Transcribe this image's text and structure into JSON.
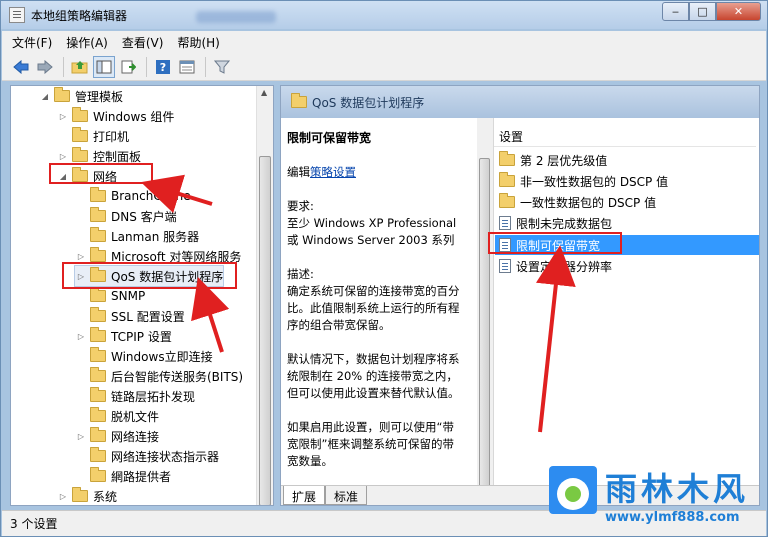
{
  "window": {
    "title": "本地组策略编辑器",
    "buttons": {
      "minimize": "‒",
      "maximize": "□",
      "close": "✕"
    }
  },
  "menu": [
    "文件(F)",
    "操作(A)",
    "查看(V)",
    "帮助(H)"
  ],
  "toolbar": {
    "icons": [
      "back-arrow-icon",
      "forward-arrow-icon",
      "up-folder-icon",
      "show-hide-tree-icon",
      "export-list-icon",
      "help-icon",
      "properties-icon",
      "filter-icon"
    ]
  },
  "tree": {
    "items": [
      {
        "label": "管理模板",
        "arrow": "◢",
        "indent": 0
      },
      {
        "label": "Windows 组件",
        "arrow": "▷",
        "indent": 1
      },
      {
        "label": "打印机",
        "arrow": "",
        "indent": 1
      },
      {
        "label": "控制面板",
        "arrow": "▷",
        "indent": 1
      },
      {
        "label": "网络",
        "arrow": "◢",
        "indent": 1
      },
      {
        "label": "BranchCache",
        "arrow": "",
        "indent": 2
      },
      {
        "label": "DNS 客户端",
        "arrow": "",
        "indent": 2
      },
      {
        "label": "Lanman 服务器",
        "arrow": "",
        "indent": 2
      },
      {
        "label": "Microsoft 对等网络服务",
        "arrow": "▷",
        "indent": 2
      },
      {
        "label": "QoS 数据包计划程序",
        "arrow": "▷",
        "indent": 2
      },
      {
        "label": "SNMP",
        "arrow": "",
        "indent": 2
      },
      {
        "label": "SSL 配置设置",
        "arrow": "",
        "indent": 2
      },
      {
        "label": "TCPIP 设置",
        "arrow": "▷",
        "indent": 2
      },
      {
        "label": "Windows立即连接",
        "arrow": "",
        "indent": 2
      },
      {
        "label": "后台智能传送服务(BITS)",
        "arrow": "",
        "indent": 2
      },
      {
        "label": "链路层拓扑发现",
        "arrow": "",
        "indent": 2
      },
      {
        "label": "脱机文件",
        "arrow": "",
        "indent": 2
      },
      {
        "label": "网络连接",
        "arrow": "▷",
        "indent": 2
      },
      {
        "label": "网络连接状态指示器",
        "arrow": "",
        "indent": 2
      },
      {
        "label": "網路提供者",
        "arrow": "",
        "indent": 2
      },
      {
        "label": "系统",
        "arrow": "▷",
        "indent": 1
      }
    ]
  },
  "right": {
    "header": "QoS 数据包计划程序",
    "description": {
      "title": "限制可保留带宽",
      "edit_prefix": "编辑",
      "edit_link": "策略设置",
      "req_label": "要求:",
      "req_line1": "至少 Windows XP Professional",
      "req_line2": "或 Windows Server 2003 系列",
      "desc_label": "描述:",
      "desc_p1_l1": "确定系统可保留的连接带宽的百分",
      "desc_p1_l2": "比。此值限制系统上运行的所有程",
      "desc_p1_l3": "序的组合带宽保留。",
      "desc_p2_l1": "默认情况下，数据包计划程序将系",
      "desc_p2_l2": "统限制在 20% 的连接带宽之内，",
      "desc_p2_l3": "但可以使用此设置来替代默认值。",
      "desc_p3_l1": "如果启用此设置，则可以使用“带",
      "desc_p3_l2": "宽限制”框来调整系统可保留的带",
      "desc_p3_l3": "宽数量。"
    },
    "settings_header": "设置",
    "settings": [
      {
        "label": "第 2 层优先级值",
        "type": "folder"
      },
      {
        "label": "非一致性数据包的 DSCP 值",
        "type": "folder"
      },
      {
        "label": "一致性数据包的 DSCP 值",
        "type": "folder"
      },
      {
        "label": "限制未完成数据包",
        "type": "doc"
      },
      {
        "label": "限制可保留带宽",
        "type": "doc",
        "selected": true
      },
      {
        "label": "设置定时器分辨率",
        "type": "doc"
      }
    ],
    "tabs": [
      "扩展",
      "标准"
    ]
  },
  "status": "3 个设置",
  "watermark": {
    "title": "雨林木风",
    "url": "www.ylmf888.com"
  },
  "colors": {
    "annotation": "#e02020",
    "selection": "#3399ff",
    "link": "#0645ad"
  }
}
